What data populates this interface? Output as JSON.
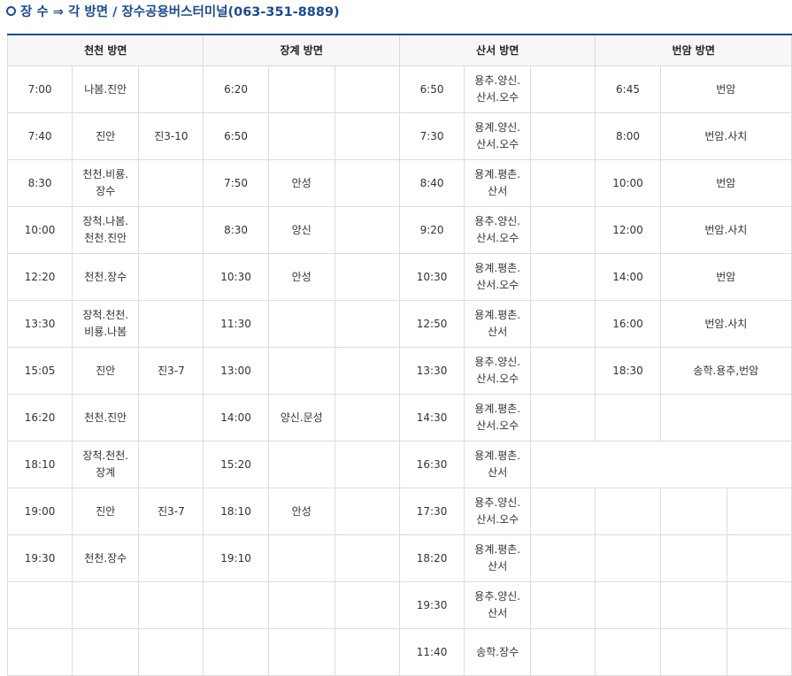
{
  "title": "장 수 ⇒ 각 방면 / 장수공용버스터미널(063-351-8889)",
  "headers": [
    "천천 방면",
    "장계 방면",
    "산서 방면",
    "번암 방면"
  ],
  "rows": [
    [
      {
        "t": "7:00"
      },
      {
        "t": "나봄.진안"
      },
      {
        "t": ""
      },
      {
        "t": "6:20"
      },
      {
        "t": ""
      },
      {
        "t": ""
      },
      {
        "t": "6:50"
      },
      {
        "t": "용추.양신.\n산서.오수"
      },
      {
        "t": ""
      },
      {
        "t": "6:45"
      },
      {
        "t": "번암",
        "cs": 2
      }
    ],
    [
      {
        "t": "7:40"
      },
      {
        "t": "진안"
      },
      {
        "t": "진3-10"
      },
      {
        "t": "6:50"
      },
      {
        "t": ""
      },
      {
        "t": ""
      },
      {
        "t": "7:30"
      },
      {
        "t": "용계.양신.\n산서.오수"
      },
      {
        "t": ""
      },
      {
        "t": "8:00"
      },
      {
        "t": "번암.사치",
        "cs": 2
      }
    ],
    [
      {
        "t": "8:30"
      },
      {
        "t": "천천.비룡.\n장수"
      },
      {
        "t": ""
      },
      {
        "t": "7:50"
      },
      {
        "t": "안성"
      },
      {
        "t": ""
      },
      {
        "t": "8:40"
      },
      {
        "t": "용계.평촌.\n산서"
      },
      {
        "t": ""
      },
      {
        "t": "10:00"
      },
      {
        "t": "번암",
        "cs": 2
      }
    ],
    [
      {
        "t": "10:00"
      },
      {
        "t": "장척.나봄.\n천천.진안"
      },
      {
        "t": ""
      },
      {
        "t": "8:30"
      },
      {
        "t": "양신"
      },
      {
        "t": ""
      },
      {
        "t": "9:20"
      },
      {
        "t": "용추.양신.\n산서.오수"
      },
      {
        "t": ""
      },
      {
        "t": "12:00"
      },
      {
        "t": "번암.사치",
        "cs": 2
      }
    ],
    [
      {
        "t": "12:20"
      },
      {
        "t": "천천.장수"
      },
      {
        "t": ""
      },
      {
        "t": "10:30"
      },
      {
        "t": "안성"
      },
      {
        "t": ""
      },
      {
        "t": "10:30"
      },
      {
        "t": "용계.평촌.\n산서.오수"
      },
      {
        "t": ""
      },
      {
        "t": "14:00"
      },
      {
        "t": "번암",
        "cs": 2
      }
    ],
    [
      {
        "t": "13:30"
      },
      {
        "t": "장척.천천.\n비룡.나봄"
      },
      {
        "t": ""
      },
      {
        "t": "11:30"
      },
      {
        "t": ""
      },
      {
        "t": ""
      },
      {
        "t": "12:50"
      },
      {
        "t": "용계.평촌.\n산서"
      },
      {
        "t": ""
      },
      {
        "t": "16:00"
      },
      {
        "t": "번암.사치",
        "cs": 2
      }
    ],
    [
      {
        "t": "15:05"
      },
      {
        "t": "진안"
      },
      {
        "t": "진3-7"
      },
      {
        "t": "13:00"
      },
      {
        "t": ""
      },
      {
        "t": ""
      },
      {
        "t": "13:30"
      },
      {
        "t": "용추.양신.\n산서.오수"
      },
      {
        "t": ""
      },
      {
        "t": "18:30"
      },
      {
        "t": "송학.용추,번암",
        "cs": 2
      }
    ],
    [
      {
        "t": "16:20"
      },
      {
        "t": "천천.진안"
      },
      {
        "t": ""
      },
      {
        "t": "14:00"
      },
      {
        "t": "양신.문성"
      },
      {
        "t": ""
      },
      {
        "t": "14:30"
      },
      {
        "t": "용계.평촌.\n산서.오수"
      },
      {
        "t": ""
      },
      {
        "t": ""
      },
      {
        "t": "",
        "cs": 2
      }
    ],
    [
      {
        "t": "18:10"
      },
      {
        "t": "장척.천천.\n장계"
      },
      {
        "t": ""
      },
      {
        "t": "15:20"
      },
      {
        "t": ""
      },
      {
        "t": ""
      },
      {
        "t": "16:30"
      },
      {
        "t": "용계.평촌.\n산서"
      },
      {
        "t": "",
        "cs": 4
      }
    ],
    [
      {
        "t": "19:00"
      },
      {
        "t": "진안"
      },
      {
        "t": "진3-7"
      },
      {
        "t": "18:10"
      },
      {
        "t": "안성"
      },
      {
        "t": ""
      },
      {
        "t": "17:30"
      },
      {
        "t": "용추.양신.\n산서.오수"
      },
      {
        "t": ""
      },
      {
        "t": ""
      },
      {
        "t": ""
      },
      {
        "t": ""
      }
    ],
    [
      {
        "t": "19:30"
      },
      {
        "t": "천천.장수"
      },
      {
        "t": ""
      },
      {
        "t": "19:10"
      },
      {
        "t": ""
      },
      {
        "t": ""
      },
      {
        "t": "18:20"
      },
      {
        "t": "용계.평촌.\n산서"
      },
      {
        "t": ""
      },
      {
        "t": ""
      },
      {
        "t": ""
      },
      {
        "t": ""
      }
    ],
    [
      {
        "t": ""
      },
      {
        "t": ""
      },
      {
        "t": ""
      },
      {
        "t": ""
      },
      {
        "t": ""
      },
      {
        "t": ""
      },
      {
        "t": "19:30"
      },
      {
        "t": "용추.양신.\n산서"
      },
      {
        "t": ""
      },
      {
        "t": ""
      },
      {
        "t": ""
      },
      {
        "t": ""
      }
    ],
    [
      {
        "t": ""
      },
      {
        "t": ""
      },
      {
        "t": ""
      },
      {
        "t": ""
      },
      {
        "t": ""
      },
      {
        "t": ""
      },
      {
        "t": "11:40"
      },
      {
        "t": "송학.장수"
      },
      {
        "t": ""
      },
      {
        "t": ""
      },
      {
        "t": ""
      },
      {
        "t": ""
      }
    ]
  ]
}
